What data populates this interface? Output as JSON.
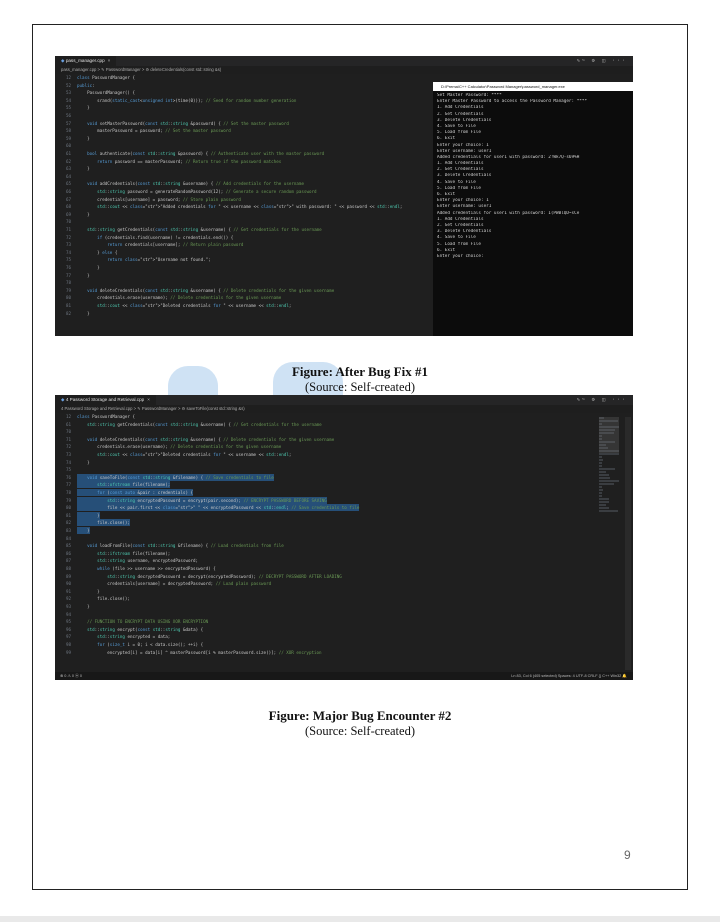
{
  "screenshot1": {
    "tab_title": "pass_manager.cpp",
    "window_icons": "✎~ ⚙ ◫ ···",
    "breadcrumb": "pass_manager.cpp > ✎ PasswordManager > ⚙ deleteCredentials(const std::string &s)",
    "code_lines": [
      {
        "n": "12",
        "t": "class PasswordManager {"
      },
      {
        "n": "52",
        "t": "public:"
      },
      {
        "n": "53",
        "t": "    PasswordManager() {"
      },
      {
        "n": "54",
        "t": "        srand(static_cast<unsigned int>(time(0))); // Seed for random number generation"
      },
      {
        "n": "55",
        "t": "    }"
      },
      {
        "n": "56",
        "t": ""
      },
      {
        "n": "57",
        "t": "    void setMasterPassword(const std::string &password) { // Set the master password"
      },
      {
        "n": "58",
        "t": "        masterPassword = password; // Set the master password"
      },
      {
        "n": "59",
        "t": "    }"
      },
      {
        "n": "60",
        "t": ""
      },
      {
        "n": "61",
        "t": "    bool authenticate(const std::string &password) { // Authenticate user with the master password"
      },
      {
        "n": "62",
        "t": "        return password == masterPassword; // Return true if the password matches"
      },
      {
        "n": "63",
        "t": "    }"
      },
      {
        "n": "64",
        "t": ""
      },
      {
        "n": "65",
        "t": "    void addCredentials(const std::string &username) { // Add credentials for the username"
      },
      {
        "n": "66",
        "t": "        std::string password = generateRandomPassword(12); // Generate a secure random password"
      },
      {
        "n": "67",
        "t": "        credentials[username] = password; // Store plain password"
      },
      {
        "n": "68",
        "t": "        std::cout << \"Added credentials for \" << username << \" with password: \" << password << std::endl;"
      },
      {
        "n": "69",
        "t": "    }"
      },
      {
        "n": "70",
        "t": ""
      },
      {
        "n": "71",
        "t": "    std::string getCredentials(const std::string &username) { // Get credentials for the username"
      },
      {
        "n": "72",
        "t": "        if (credentials.find(username) != credentials.end()) {"
      },
      {
        "n": "73",
        "t": "            return credentials[username]; // Return plain password"
      },
      {
        "n": "74",
        "t": "        } else {"
      },
      {
        "n": "75",
        "t": "            return \"Username not found.\";"
      },
      {
        "n": "76",
        "t": "        }"
      },
      {
        "n": "77",
        "t": "    }"
      },
      {
        "n": "78",
        "t": ""
      },
      {
        "n": "79",
        "t": "    void deleteCredentials(const std::string &username) { // Delete credentials for the given username"
      },
      {
        "n": "80",
        "t": "        credentials.erase(username); // Delete credentials for the given username"
      },
      {
        "n": "81",
        "t": "        std::cout << \"Deleted credentials for \" << username << std::endl;"
      },
      {
        "n": "82",
        "t": "    }"
      }
    ],
    "terminal_title": "D:\\Prema\\C++ Calculator\\Password Manager\\password_manager.exe",
    "terminal_lines": [
      "Set Master Password: ****",
      "Enter Master Password to access the Password Manager: ****",
      "1. Add Credentials",
      "2. Get Credentials",
      "3. Delete Credentials",
      "4. Save to File",
      "5. Load from File",
      "6. Exit",
      "Enter your choice: 1",
      "Enter username: user1",
      "Added credentials for user1 with password: 2!Wk7Q-s69%H",
      "1. Add Credentials",
      "2. Get Credentials",
      "3. Delete Credentials",
      "4. Save to File",
      "5. Load from File",
      "6. Exit",
      "Enter your choice: 1",
      "Enter username: user1",
      "Added credentials for user1 with password: 1(PWBlQD~sCe",
      "1. Add Credentials",
      "2. Get Credentials",
      "3. Delete Credentials",
      "4. Save to File",
      "5. Load from File",
      "6. Exit",
      "Enter your choice:"
    ]
  },
  "caption1": {
    "title": "Figure: After Bug Fix #1",
    "source": "(Source: Self-created)"
  },
  "screenshot2": {
    "tab_title": "4 Password Storage and Retrieval.cpp",
    "window_icons": "✎~ ⚙ ◫ ···",
    "breadcrumb": "4 Password Storage and Retrieval.cpp > ✎ PasswordManager > ⚙ saveToFile(const std::string &s)",
    "code_lines": [
      {
        "n": "12",
        "t": "class PasswordManager {"
      },
      {
        "n": "61",
        "t": "    std::string getCredentials(const std::string &username) { // Get credentials for the username"
      },
      {
        "n": "70",
        "t": ""
      },
      {
        "n": "71",
        "t": "    void deleteCredentials(const std::string &username) { // Delete credentials for the given username"
      },
      {
        "n": "72",
        "t": "        credentials.erase(username); // Delete credentials for the given username"
      },
      {
        "n": "73",
        "t": "        std::cout << \"Deleted credentials for \" << username << std::endl;"
      },
      {
        "n": "74",
        "t": "    }"
      },
      {
        "n": "75",
        "t": ""
      },
      {
        "n": "76",
        "t": "    void saveToFile(const std::string &filename) { // Save credentials to file"
      },
      {
        "n": "77",
        "t": "        std::ofstream file(filename);"
      },
      {
        "n": "78",
        "t": "        for (const auto &pair : credentials) {"
      },
      {
        "n": "79",
        "t": "            std::string encryptedPassword = encrypt(pair.second); // ENCRYPT PASSWORD BEFORE SAVING"
      },
      {
        "n": "80",
        "t": "            file << pair.first << \" \" << encryptedPassword << std::endl; // Save credentials to file"
      },
      {
        "n": "81",
        "t": "        }"
      },
      {
        "n": "82",
        "t": "        file.close();"
      },
      {
        "n": "83",
        "t": "    }"
      },
      {
        "n": "84",
        "t": ""
      },
      {
        "n": "85",
        "t": "    void loadFromFile(const std::string &filename) { // Load credentials from file"
      },
      {
        "n": "86",
        "t": "        std::ifstream file(filename);"
      },
      {
        "n": "87",
        "t": "        std::string username, encryptedPassword;"
      },
      {
        "n": "88",
        "t": "        while (file >> username >> encryptedPassword) {"
      },
      {
        "n": "89",
        "t": "            std::string decryptedPassword = decrypt(encryptedPassword); // DECRYPT PASSWORD AFTER LOADING"
      },
      {
        "n": "90",
        "t": "            credentials[username] = decryptedPassword; // Load plain password"
      },
      {
        "n": "91",
        "t": "        }"
      },
      {
        "n": "92",
        "t": "        file.close();"
      },
      {
        "n": "93",
        "t": "    }"
      },
      {
        "n": "94",
        "t": ""
      },
      {
        "n": "95",
        "t": "    // FUNCTION TO ENCRYPT DATA USING XOR ENCRYPTION"
      },
      {
        "n": "96",
        "t": "    std::string encrypt(const std::string &data) {"
      },
      {
        "n": "97",
        "t": "        std::string encrypted = data;"
      },
      {
        "n": "98",
        "t": "        for (size_t i = 0; i < data.size(); ++i) {"
      },
      {
        "n": "99",
        "t": "            encrypted[i] = data[i] ^ masterPassword[i % masterPassword.size()]; // XOR encryption"
      }
    ],
    "highlight_range": [
      76,
      83
    ],
    "status_left": "⊗ 0 ⚠ 0    ⓦ 0",
    "status_right": "Ln 83, Col 6 (405 selected)   Spaces: 4   UTF-8   CRLF   {} C++   Win32   🔔"
  },
  "caption2": {
    "title": "Figure: Major Bug Encounter #2",
    "source": "(Source: Self-created)"
  },
  "page_number": "9"
}
